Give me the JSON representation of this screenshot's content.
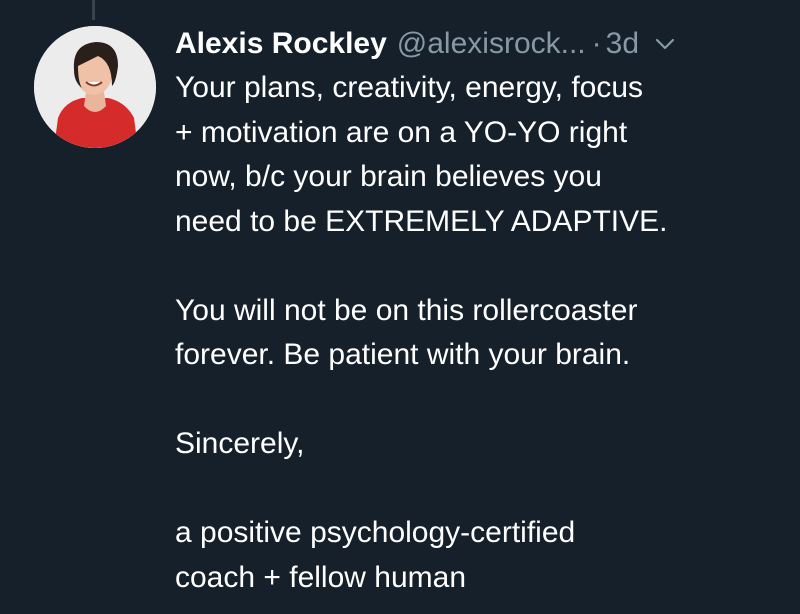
{
  "tweet": {
    "author_name": "Alexis Rockley",
    "handle": "@alexisrock...",
    "separator": "·",
    "time": "3d",
    "lines": [
      "Your plans, creativity, energy, focus",
      "+ motivation are on a YO-YO right",
      "now, b/c your brain believes you",
      "need to be EXTREMELY ADAPTIVE.",
      "",
      "You will not be on this rollercoaster",
      "forever. Be patient with your brain.",
      "",
      "Sincerely,",
      "",
      "a positive psychology-certified",
      "coach + fellow human"
    ]
  },
  "icons": {
    "avatar": "profile-photo",
    "menu": "chevron-down-icon"
  },
  "colors": {
    "background": "#15202b",
    "text_primary": "#ffffff",
    "text_secondary": "#8899a6"
  }
}
